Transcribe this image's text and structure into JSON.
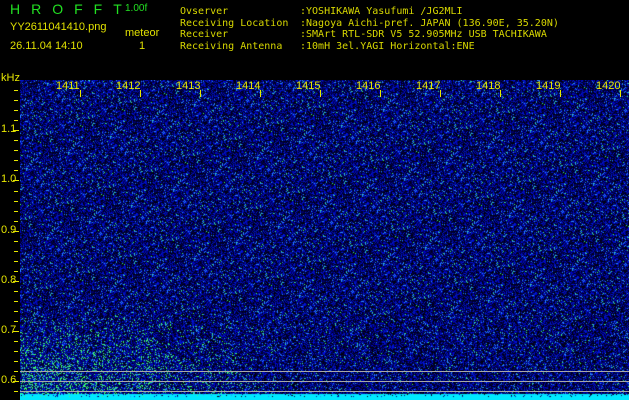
{
  "header": {
    "app_name": "HROFFT",
    "version": "1.00f",
    "filename": "YY2611041410.png",
    "datetime": "26.11.04 14:10",
    "mode_label": "meteor",
    "meteor_count": "1"
  },
  "info": [
    {
      "label": "Ovserver",
      "value": ":YOSHIKAWA Yasufumi /JG2MLI"
    },
    {
      "label": "Receiving Location",
      "value": ":Nagoya Aichi-pref. JAPAN (136.90E, 35.20N)"
    },
    {
      "label": "Receiver",
      "value": ":SMArt RTL-SDR V5 52.905MHz USB TACHIKAWA"
    },
    {
      "label": "Receiving Antenna",
      "value": ":10mH 3el.YAGI Horizontal:ENE"
    }
  ],
  "chart_data": {
    "type": "heatmap",
    "ylabel": "kHz",
    "x_tick_labels": [
      "1411",
      "1412",
      "1413",
      "1414",
      "1415",
      "1416",
      "1417",
      "1418",
      "1419",
      "1420"
    ],
    "y_tick_labels": [
      "1.1",
      "1.0",
      "0.9",
      "0.8",
      "0.7",
      "0.6"
    ],
    "y_ticks": [
      1.1,
      1.0,
      0.9,
      0.8,
      0.7,
      0.6
    ],
    "ylim": [
      0.563,
      1.2
    ],
    "x_tick_values": [
      1411,
      1412,
      1413,
      1414,
      1415,
      1416,
      1417,
      1418,
      1419,
      1420
    ],
    "xlim": [
      1410,
      1420
    ],
    "reference_lines_khz": [
      0.62,
      0.6,
      0.58
    ],
    "colors": {
      "background": "#000000",
      "noise": "#1020c0",
      "signal": "#40ff60",
      "baseline": "#00e8ff",
      "text": "#e8e800",
      "logo": "#22e022"
    }
  }
}
